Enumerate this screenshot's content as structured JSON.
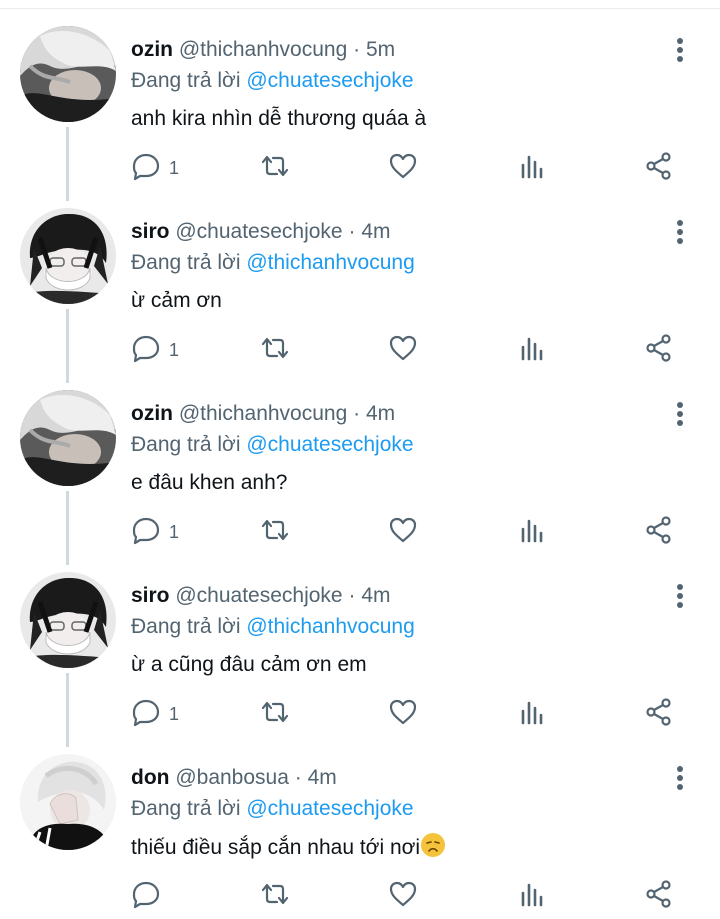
{
  "tweets": [
    {
      "name": "ozin",
      "handle": "@thichanhvocung",
      "time": "5m",
      "reply_prefix": "Đang trả lời",
      "reply_to": "@chuatesechjoke",
      "text": "anh kira nhìn dễ thương quáa à",
      "reply_count": "1",
      "avatar": "white-hair-avatar"
    },
    {
      "name": "siro",
      "handle": "@chuatesechjoke",
      "time": "4m",
      "reply_prefix": "Đang trả lời",
      "reply_to": "@thichanhvocung",
      "text": "ừ cảm ơn",
      "reply_count": "1",
      "avatar": "masked-dark-hair-avatar"
    },
    {
      "name": "ozin",
      "handle": "@thichanhvocung",
      "time": "4m",
      "reply_prefix": "Đang trả lời",
      "reply_to": "@chuatesechjoke",
      "text": "e đâu khen anh?",
      "reply_count": "1",
      "avatar": "white-hair-avatar"
    },
    {
      "name": "siro",
      "handle": "@chuatesechjoke",
      "time": "4m",
      "reply_prefix": "Đang trả lời",
      "reply_to": "@thichanhvocung",
      "text": "ừ a cũng đâu cảm ơn em",
      "reply_count": "1",
      "avatar": "masked-dark-hair-avatar"
    },
    {
      "name": "don",
      "handle": "@banbosua",
      "time": "4m",
      "reply_prefix": "Đang trả lời",
      "reply_to": "@chuatesechjoke",
      "text": "thiếu điều sắp cắn nhau tới nơi",
      "reply_count": "",
      "avatar": "white-hair-hand-avatar",
      "trailing_emoji": "disappointed-face-emoji"
    }
  ],
  "separator": "·",
  "icons": [
    "more-vertical-icon",
    "reply-icon",
    "retweet-icon",
    "like-icon",
    "analytics-icon",
    "share-icon"
  ],
  "colors": {
    "accent": "#1d9bf0",
    "secondary_text": "#536471",
    "primary_text": "#0f1419",
    "thread_line": "#cfd9de"
  }
}
